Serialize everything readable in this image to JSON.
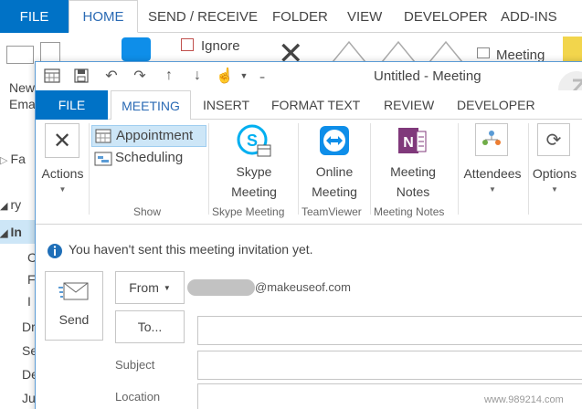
{
  "background_window": {
    "file_tab": "FILE",
    "tabs": [
      "HOME",
      "SEND / RECEIVE",
      "FOLDER",
      "VIEW",
      "DEVELOPER",
      "ADD-INS"
    ],
    "ignore_label": "Ignore",
    "meeting_label": "Meeting",
    "new_email_partial": [
      "New",
      "Ema"
    ],
    "sidebar_partial": [
      "Fa",
      "ry",
      "In",
      "C",
      "F",
      "I",
      "Dr",
      "Se",
      "De",
      "Ju"
    ]
  },
  "meeting_window": {
    "title": "Untitled - Meeting",
    "tabs": [
      "FILE",
      "MEETING",
      "INSERT",
      "FORMAT TEXT",
      "REVIEW",
      "DEVELOPER"
    ],
    "ribbon": {
      "actions_label": "Actions",
      "appointment_label": "Appointment",
      "scheduling_label": "Scheduling",
      "show_group": "Show",
      "skype_label": [
        "Skype",
        "Meeting"
      ],
      "skype_group": "Skype Meeting",
      "online_label": [
        "Online",
        "Meeting"
      ],
      "teamviewer_group": "TeamViewer",
      "notes_label": [
        "Meeting",
        "Notes"
      ],
      "notes_group": "Meeting Notes",
      "attendees_label": "Attendees",
      "options_label": "Options"
    },
    "info_message": "You haven't sent this meeting invitation yet.",
    "send_label": "Send",
    "from_label": "From",
    "from_email": "@makeuseof.com",
    "to_label": "To...",
    "subject_label": "Subject",
    "location_label": "Location"
  },
  "watermark": "www.989214.com",
  "colors": {
    "file_blue": "#0072c6",
    "tab_active": "#2a6ab4",
    "skype_blue": "#00aff0",
    "teamviewer_blue": "#0e8ee9",
    "onenote_purple": "#80397b"
  }
}
